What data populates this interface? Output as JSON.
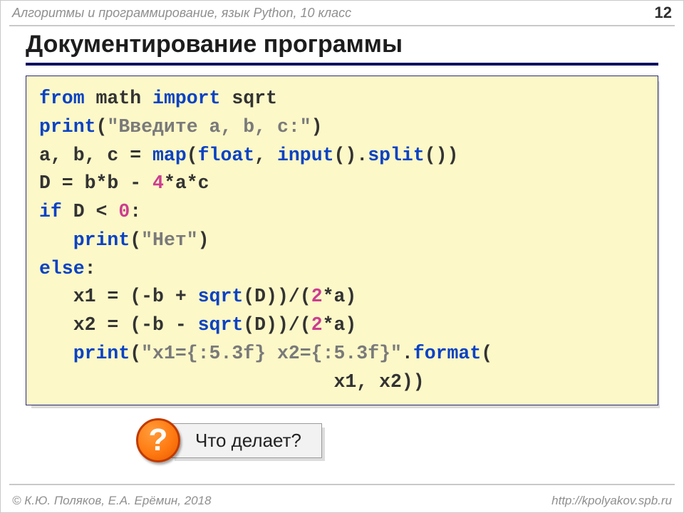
{
  "header": {
    "course": "Алгоритмы и программирование, язык Python, 10 класс",
    "page": "12"
  },
  "title": "Документирование программы",
  "code": {
    "l1": {
      "a": "from",
      "b": " math ",
      "c": "import",
      "d": " sqrt"
    },
    "l2": {
      "a": "print",
      "b": "(",
      "c": "\"Введите a, b, c:\"",
      "d": ")"
    },
    "l3": {
      "a": "a, b, c = ",
      "b": "map",
      "c": "(",
      "d": "float",
      "e": ", ",
      "f": "input",
      "g": "().",
      "h": "split",
      "i": "())"
    },
    "l4": {
      "a": "D = b*b - ",
      "b": "4",
      "c": "*a*c"
    },
    "l5": {
      "a": "if",
      "b": " D < ",
      "c": "0",
      "d": ":"
    },
    "l6": {
      "a": "   ",
      "b": "print",
      "c": "(",
      "d": "\"Нет\"",
      "e": ")"
    },
    "l7": {
      "a": "else",
      "b": ":"
    },
    "l8": {
      "a": "   x1 = (-b + ",
      "b": "sqrt",
      "c": "(D))/(",
      "d": "2",
      "e": "*a)"
    },
    "l9": {
      "a": "   x2 = (-b - ",
      "b": "sqrt",
      "c": "(D))/(",
      "d": "2",
      "e": "*a)"
    },
    "l10": {
      "a": "   ",
      "b": "print",
      "c": "(",
      "d": "\"x1={:5.3f} x2={:5.3f}\"",
      "e": ".",
      "f": "format",
      "g": "("
    },
    "l11": {
      "a": "                          x1, x2))"
    }
  },
  "question": {
    "mark": "?",
    "text": "Что делает?"
  },
  "footer": {
    "copyright": "© К.Ю. Поляков, Е.А. Ерёмин, 2018",
    "url": "http://kpolyakov.spb.ru"
  }
}
